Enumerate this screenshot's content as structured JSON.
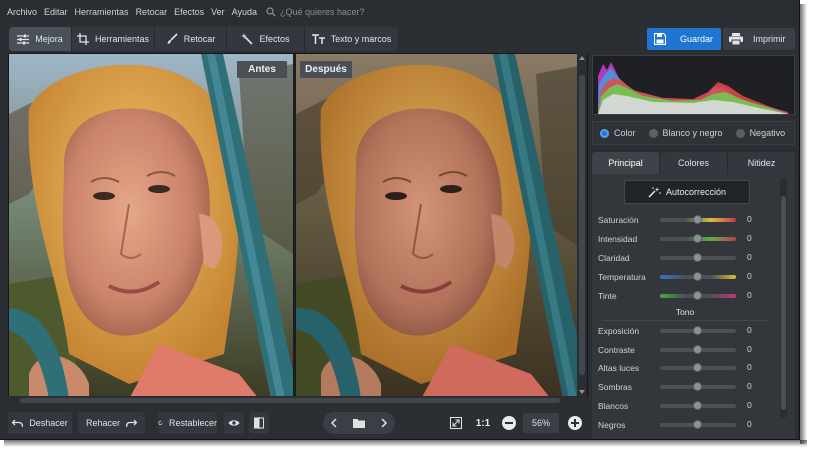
{
  "menu": {
    "items": [
      "Archivo",
      "Editar",
      "Herramientas",
      "Retocar",
      "Efectos",
      "Ver",
      "Ayuda"
    ],
    "search_placeholder": "¿Qué quieres hacer?"
  },
  "toolbar": {
    "tabs": [
      {
        "label": "Mejora",
        "icon": "sliders-icon",
        "active": true
      },
      {
        "label": "Herramientas",
        "icon": "crop-icon",
        "active": false
      },
      {
        "label": "Retocar",
        "icon": "brush-icon",
        "active": false
      },
      {
        "label": "Efectos",
        "icon": "magic-wand-icon",
        "active": false
      },
      {
        "label": "Texto y marcos",
        "icon": "text-icon",
        "active": false
      }
    ],
    "save_label": "Guardar",
    "print_label": "Imprimir"
  },
  "viewer": {
    "before_label": "Antes",
    "after_label": "Después"
  },
  "bottom": {
    "undo_label": "Deshacer",
    "redo_label": "Rehacer",
    "reset_label": "Restablecer",
    "zoom_ratio_label": "1:1",
    "zoom_value": "56%"
  },
  "panel": {
    "color_modes": [
      {
        "label": "Color",
        "selected": true
      },
      {
        "label": "Blanco y negro",
        "selected": false
      },
      {
        "label": "Negativo",
        "selected": false
      }
    ],
    "tabs": [
      {
        "label": "Principal",
        "active": true
      },
      {
        "label": "Colores",
        "active": false
      },
      {
        "label": "Nitidez",
        "active": false
      }
    ],
    "autocorrect_label": "Autocorrección",
    "sliders_main": [
      {
        "label": "Saturación",
        "value": "0",
        "gradient": [
          "#4b4f56",
          "#4b4f56",
          "#d8c040",
          "#c03a4e"
        ]
      },
      {
        "label": "Intensidad",
        "value": "0",
        "gradient": [
          "#4b4f56",
          "#4b4f56",
          "#5fb04a",
          "#c03a4e"
        ]
      },
      {
        "label": "Claridad",
        "value": "0",
        "gradient": [
          "#4b4f56",
          "#4b4f56",
          "#4b4f56",
          "#4b4f56"
        ]
      },
      {
        "label": "Temperatura",
        "value": "0",
        "gradient": [
          "#3a6fd0",
          "#4b4f56",
          "#4b4f56",
          "#d8c040"
        ]
      },
      {
        "label": "Tinte",
        "value": "0",
        "gradient": [
          "#45a84a",
          "#4b4f56",
          "#4b4f56",
          "#c03a7a"
        ]
      }
    ],
    "tone_title": "Tono",
    "sliders_tone": [
      {
        "label": "Exposición",
        "value": "0"
      },
      {
        "label": "Contraste",
        "value": "0"
      },
      {
        "label": "Altas luces",
        "value": "0"
      },
      {
        "label": "Sombras",
        "value": "0"
      },
      {
        "label": "Blancos",
        "value": "0"
      },
      {
        "label": "Negros",
        "value": "0"
      }
    ]
  },
  "colors": {
    "accent": "#1e76d2",
    "background": "#2b2e33"
  }
}
